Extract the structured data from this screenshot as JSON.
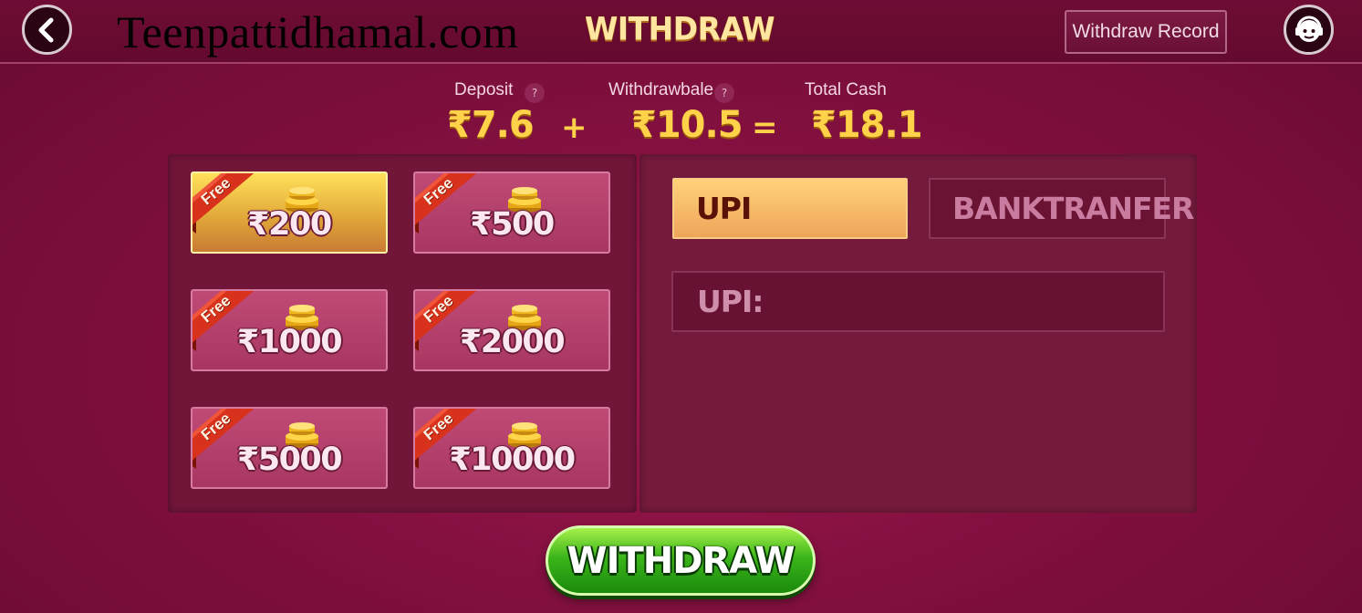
{
  "header": {
    "watermark": "Teenpattidhamal.com",
    "title": "WITHDRAW",
    "record_label": "Withdraw Record"
  },
  "summary": {
    "deposit_label": "Deposit",
    "deposit_value": "₹7.6",
    "withdrawable_label": "Withdrawbale",
    "withdrawable_value": "₹10.5",
    "total_label": "Total Cash",
    "total_value": "₹18.1",
    "plus": "+",
    "equals": "=",
    "help_mark": "?"
  },
  "amounts": [
    {
      "badge": "Free",
      "label": "₹200",
      "selected": true
    },
    {
      "badge": "Free",
      "label": "₹500",
      "selected": false
    },
    {
      "badge": "Free",
      "label": "₹1000",
      "selected": false
    },
    {
      "badge": "Free",
      "label": "₹2000",
      "selected": false
    },
    {
      "badge": "Free",
      "label": "₹5000",
      "selected": false
    },
    {
      "badge": "Free",
      "label": "₹10000",
      "selected": false
    }
  ],
  "methods": {
    "active": "UPI",
    "inactive": "BANKTRANFER"
  },
  "upi_field": {
    "label": "UPI:"
  },
  "action": {
    "withdraw_label": "WITHDRAW"
  },
  "colors": {
    "background": "#82103f",
    "gold": "#ffd24a",
    "selected_card": "#e1a93a",
    "card": "#b03f6a",
    "button_green": "#3bb51a"
  }
}
